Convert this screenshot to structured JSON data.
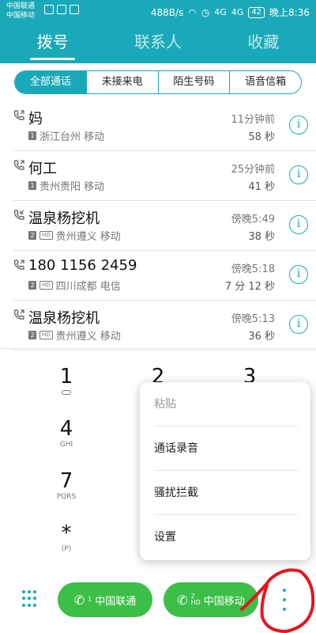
{
  "statusbar": {
    "carrier1": "中国联通",
    "carrier2": "中国移动",
    "speed": "488B/s",
    "signal1": "4G",
    "signal2": "4G",
    "battery": "42",
    "time": "晚上8:36"
  },
  "tabs": [
    {
      "label": "拨号"
    },
    {
      "label": "联系人"
    },
    {
      "label": "收藏"
    }
  ],
  "filter": [
    {
      "label": "全部通话"
    },
    {
      "label": "未接来电"
    },
    {
      "label": "陌生号码"
    },
    {
      "label": "语音信箱"
    }
  ],
  "calls": [
    {
      "name": "妈",
      "sim": "1",
      "hd": "",
      "location": "浙江台州 移动",
      "time": "11分钟前",
      "duration": "58 秒"
    },
    {
      "name": "何工",
      "sim": "1",
      "hd": "",
      "location": "贵州贵阳 移动",
      "time": "25分钟前",
      "duration": "41 秒"
    },
    {
      "name": "温泉杨挖机",
      "sim": "2",
      "hd": "HD",
      "location": "贵州遵义 移动",
      "time": "傍晚5:49",
      "duration": "38 秒"
    },
    {
      "name": "180 1156 2459",
      "sim": "2",
      "hd": "HD",
      "location": "四川成都 电信",
      "time": "傍晚5:18",
      "duration": "7 分 12 秒"
    },
    {
      "name": "温泉杨挖机",
      "sim": "2",
      "hd": "HD",
      "location": "贵州遵义 移动",
      "time": "傍晚5:13",
      "duration": "36 秒"
    }
  ],
  "dialpad": {
    "k1": "1",
    "k2": "2",
    "k3": "3",
    "k4": "4",
    "k4_letters": "GHI",
    "k7": "7",
    "k7_letters": "PQRS",
    "kstar": "*",
    "kstar_letters": "(P)"
  },
  "menu": {
    "paste": "粘贴",
    "record": "通话录音",
    "block": "骚扰拦截",
    "settings": "设置"
  },
  "bottom": {
    "call1": "中国联通",
    "call1_sim": "1",
    "call2": "中国移动",
    "call2_sim": "2",
    "call2_hd": "HD"
  },
  "colors": {
    "accent": "#1aa9b8",
    "call_green": "#3bbf47",
    "annotation_red": "#e8141c"
  }
}
